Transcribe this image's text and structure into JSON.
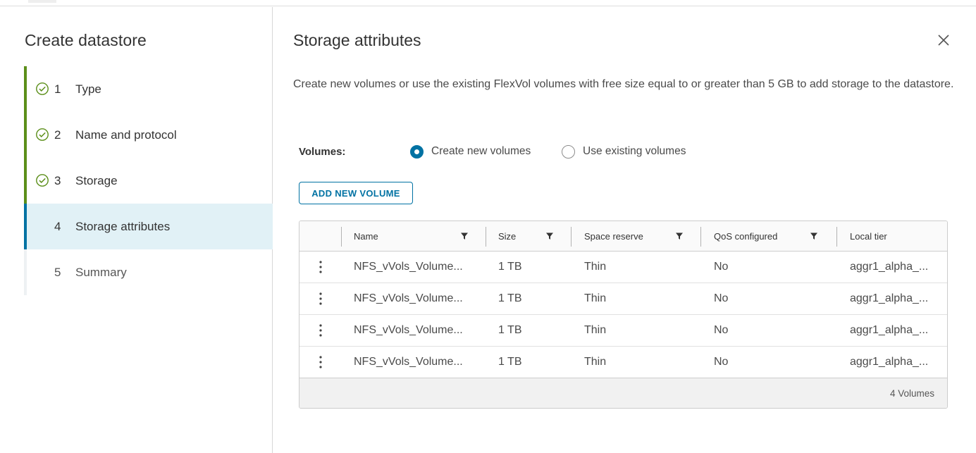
{
  "wizard": {
    "title": "Create datastore",
    "steps": [
      {
        "number": "1",
        "label": "Type",
        "status": "complete"
      },
      {
        "number": "2",
        "label": "Name and protocol",
        "status": "complete"
      },
      {
        "number": "3",
        "label": "Storage",
        "status": "complete"
      },
      {
        "number": "4",
        "label": "Storage attributes",
        "status": "current"
      },
      {
        "number": "5",
        "label": "Summary",
        "status": "pending"
      }
    ]
  },
  "panel": {
    "title": "Storage attributes",
    "close_icon": "close-icon",
    "description": "Create new volumes or use the existing FlexVol volumes with free size equal to or greater than 5 GB to add storage to the datastore."
  },
  "volumes": {
    "label": "Volumes:",
    "options": [
      {
        "label": "Create new volumes",
        "selected": true
      },
      {
        "label": "Use existing volumes",
        "selected": false
      }
    ]
  },
  "add_button": {
    "label": "ADD NEW VOLUME"
  },
  "table": {
    "columns": [
      "Name",
      "Size",
      "Space reserve",
      "QoS configured",
      "Local tier"
    ],
    "rows": [
      [
        "NFS_vVols_Volume...",
        "1 TB",
        "Thin",
        "No",
        "aggr1_alpha_..."
      ],
      [
        "NFS_vVols_Volume...",
        "1 TB",
        "Thin",
        "No",
        "aggr1_alpha_..."
      ],
      [
        "NFS_vVols_Volume...",
        "1 TB",
        "Thin",
        "No",
        "aggr1_alpha_..."
      ],
      [
        "NFS_vVols_Volume...",
        "1 TB",
        "Thin",
        "No",
        "aggr1_alpha_..."
      ]
    ],
    "footer": "4 Volumes"
  },
  "colors": {
    "accent": "#0072a3",
    "complete": "#5c8f1a",
    "current_step_bg": "#e1f1f6"
  }
}
